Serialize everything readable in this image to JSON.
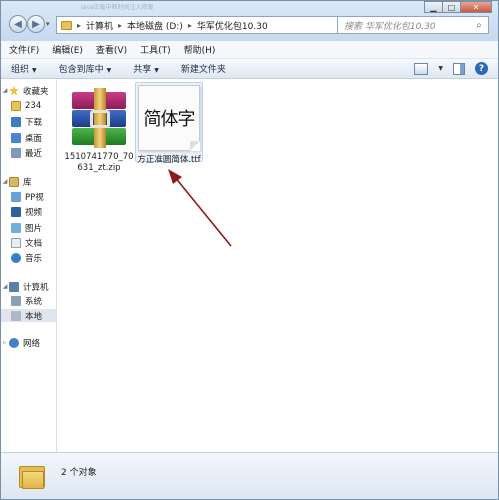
{
  "window": {
    "caption": "Java正版中断时间注入修复",
    "buttons": {
      "minimize": "▁",
      "maximize": "□",
      "close": "✕"
    }
  },
  "address": {
    "crumbs": [
      "计算机",
      "本地磁盘 (D:)",
      "华军优化包10.30"
    ]
  },
  "search": {
    "placeholder": "搜索 华军优化包10.30"
  },
  "menubar": {
    "items": [
      "文件(F)",
      "编辑(E)",
      "查看(V)",
      "工具(T)",
      "帮助(H)"
    ]
  },
  "commandbar": {
    "organize": "组织",
    "include": "包含到库中",
    "share": "共享",
    "new_folder": "新建文件夹"
  },
  "navpane": {
    "favorites": "收藏夹",
    "fav_items": [
      "234",
      "下载",
      "桌面",
      "最近"
    ],
    "libraries": "库",
    "lib_items": [
      "PP视",
      "视频",
      "图片",
      "文档",
      "音乐"
    ],
    "computer": "计算机",
    "pc_items": [
      "系统",
      "本地"
    ],
    "network": "网络"
  },
  "files": [
    {
      "name": "1510741770_70631_zt.zip",
      "type": "rar-archive"
    },
    {
      "name": "方正准圆简体.ttf",
      "type": "font",
      "preview": "简体字"
    }
  ],
  "details": {
    "count": "2 个对象"
  },
  "colors": {
    "arrow": "#8b1a1a",
    "accent": "#2e68b8"
  }
}
